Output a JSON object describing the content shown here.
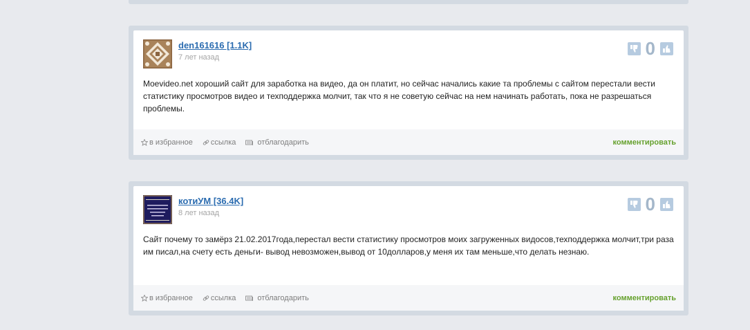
{
  "comments": [
    {
      "username": "den161616 [1.1K]",
      "time": "7 лет назад",
      "votes": "0",
      "text": "Moevideo.net хороший сайт для заработка на видео, да он платит, но сейчас начались какие та проблемы с сайтом перестали вести статистику просмотров видео и техподдержка молчит, так что я не советую сейчас на нем начинать работать, пока не разрешаться проблемы.",
      "actions": {
        "favorite": "в избранное",
        "link": "ссылка",
        "thank": "отблагодарить",
        "comment": "комментировать"
      },
      "avatar_icon": "ornament-avatar"
    },
    {
      "username": "котиУМ [36.4K]",
      "time": "8 лет назад",
      "votes": "0",
      "text": "Сайт почему то замёрз 21.02.2017года,перестал вести статистику просмотров моих загруженных видосов,техподдержка молчит,три раза им писал,на счету есть деньги- вывод невозможен,вывод от 10долларов,у меня их там меньше,что делать незнаю.",
      "actions": {
        "favorite": "в избранное",
        "link": "ссылка",
        "thank": "отблагодарить",
        "comment": "комментировать"
      },
      "avatar_icon": "dark-card-avatar"
    }
  ],
  "colors": {
    "page_bg": "#e8eaee",
    "card_border": "#d3dae2",
    "username_link": "#2b6cb0",
    "comment_link": "#66a12e",
    "vote_button": "#b6cbe0",
    "vote_count": "#a4b7ca"
  }
}
